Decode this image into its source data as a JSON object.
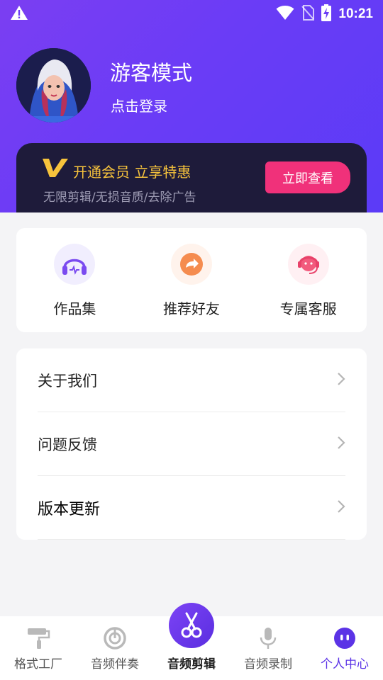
{
  "status_bar": {
    "time": "10:21",
    "icons": [
      "warning-icon",
      "wifi-icon",
      "no-sim-icon",
      "battery-charging-icon"
    ]
  },
  "profile": {
    "username": "游客模式",
    "login_link": "点击登录"
  },
  "vip": {
    "title": "开通会员 立享特惠",
    "subtitle": "无限剪辑/无损音质/去除广告",
    "button_label": "立即查看",
    "accent": "#f7c33c",
    "button_color": "#f0317a"
  },
  "quick_actions": [
    {
      "label": "作品集",
      "icon": "headphones-icon"
    },
    {
      "label": "推荐好友",
      "icon": "share-icon"
    },
    {
      "label": "专属客服",
      "icon": "customer-service-icon"
    }
  ],
  "menu": {
    "items": [
      {
        "label": "关于我们"
      },
      {
        "label": "问题反馈"
      },
      {
        "label": "版本更新"
      }
    ]
  },
  "tab_bar": {
    "tabs": [
      {
        "label": "格式工厂",
        "icon": "paint-roller-icon"
      },
      {
        "label": "音频伴奏",
        "icon": "disc-icon"
      },
      {
        "label": "音频剪辑",
        "icon": "scissors-icon"
      },
      {
        "label": "音频录制",
        "icon": "microphone-icon"
      },
      {
        "label": "个人中心",
        "icon": "profile-face-icon"
      }
    ],
    "active_color": "#5b33e6"
  }
}
